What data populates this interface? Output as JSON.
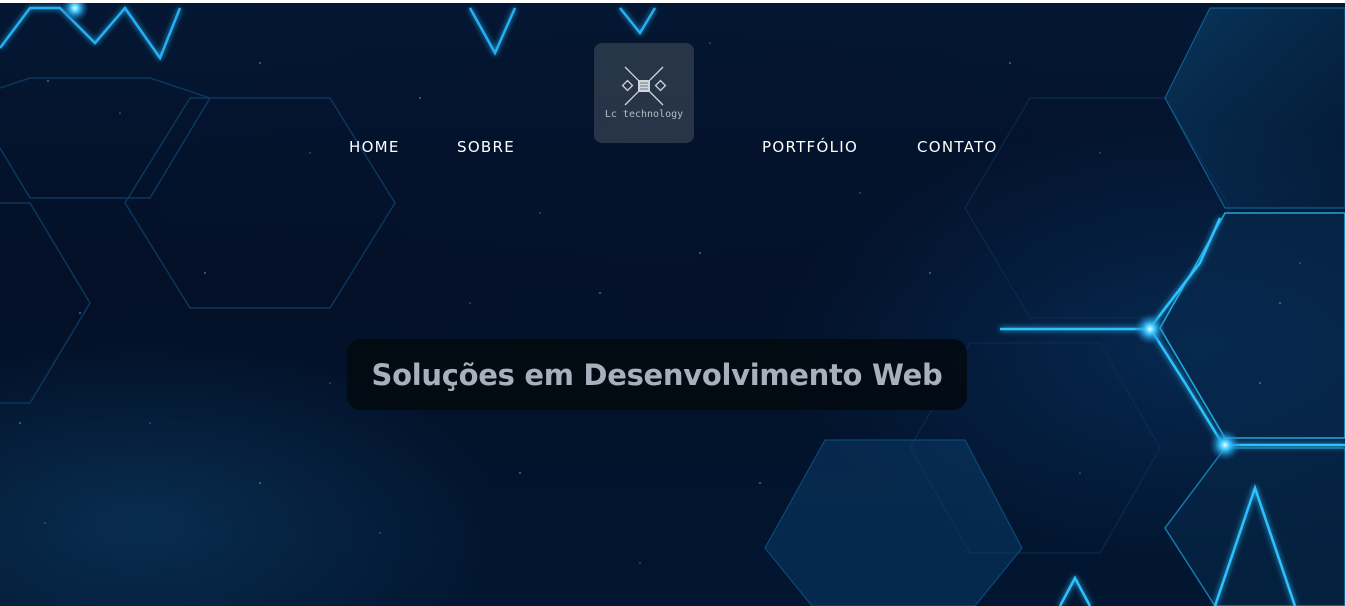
{
  "nav": {
    "items": [
      {
        "label": "HOME"
      },
      {
        "label": "SOBRE"
      },
      {
        "label": "PORTFÓLIO"
      },
      {
        "label": "CONTATO"
      }
    ]
  },
  "logo": {
    "text": "Lc technology",
    "icon": "circuit-chip-icon"
  },
  "hero": {
    "headline": "Soluções em Desenvolvimento Web",
    "background": "hexagon-tech-background"
  },
  "colors": {
    "background_dark": "#031027",
    "glow_accent": "#19b4ff",
    "nav_text": "#ffffff",
    "headline_text": "#a9afbb"
  }
}
